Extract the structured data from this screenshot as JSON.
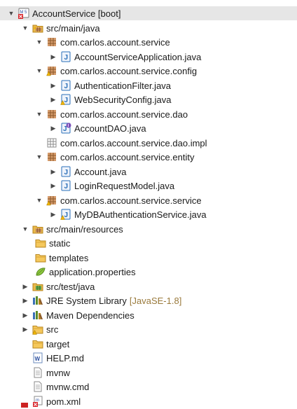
{
  "tree": {
    "rows": [
      {
        "label": "AccountService [boot]",
        "icon": "maven-project-icon",
        "expanded": true,
        "selected": true
      },
      {
        "label": "src/main/java",
        "icon": "source-folder-icon",
        "expanded": true
      },
      {
        "label": "com.carlos.account.service",
        "icon": "package-icon",
        "expanded": true
      },
      {
        "label": "AccountServiceApplication.java",
        "icon": "java-file-icon",
        "expanded": false
      },
      {
        "label": "com.carlos.account.service.config",
        "icon": "package-warning-icon",
        "expanded": true
      },
      {
        "label": "AuthenticationFilter.java",
        "icon": "java-file-icon",
        "expanded": false
      },
      {
        "label": "WebSecurityConfig.java",
        "icon": "java-file-warning-icon",
        "expanded": false
      },
      {
        "label": "com.carlos.account.service.dao",
        "icon": "package-icon",
        "expanded": true
      },
      {
        "label": "AccountDAO.java",
        "icon": "java-interface-icon",
        "expanded": false
      },
      {
        "label": "com.carlos.account.service.dao.impl",
        "icon": "empty-package-icon",
        "expanded": null
      },
      {
        "label": "com.carlos.account.service.entity",
        "icon": "package-icon",
        "expanded": true
      },
      {
        "label": "Account.java",
        "icon": "java-file-icon",
        "expanded": false
      },
      {
        "label": "LoginRequestModel.java",
        "icon": "java-file-icon",
        "expanded": false
      },
      {
        "label": "com.carlos.account.service.service",
        "icon": "package-warning-icon",
        "expanded": true
      },
      {
        "label": "MyDBAuthenticationService.java",
        "icon": "java-file-warning-icon",
        "expanded": false
      },
      {
        "label": "src/main/resources",
        "icon": "resource-folder-icon",
        "expanded": true
      },
      {
        "label": "static",
        "icon": "folder-icon",
        "expanded": null
      },
      {
        "label": "templates",
        "icon": "folder-icon",
        "expanded": null
      },
      {
        "label": "application.properties",
        "icon": "properties-file-icon",
        "expanded": null
      },
      {
        "label": "src/test/java",
        "icon": "test-source-folder-icon",
        "expanded": false
      },
      {
        "label": "JRE System Library",
        "decoration": "[JavaSE-1.8]",
        "icon": "library-icon",
        "expanded": false
      },
      {
        "label": "Maven Dependencies",
        "icon": "library-icon",
        "expanded": false
      },
      {
        "label": "src",
        "icon": "folder-warning-icon",
        "expanded": false
      },
      {
        "label": "target",
        "icon": "folder-icon",
        "expanded": null
      },
      {
        "label": "HELP.md",
        "icon": "markdown-file-icon",
        "expanded": null
      },
      {
        "label": "mvnw",
        "icon": "text-file-icon",
        "expanded": null
      },
      {
        "label": "mvnw.cmd",
        "icon": "text-file-icon",
        "expanded": null
      },
      {
        "label": "pom.xml",
        "icon": "maven-pom-icon",
        "expanded": null
      }
    ]
  },
  "colors": {
    "selection": "#e6e6e6",
    "package": "#a06c2c",
    "java": "#2a6fb8",
    "folder": "#e9b84a",
    "warning": "#f0b400",
    "error": "#d8282e",
    "decoration": "#9a7a3c"
  }
}
